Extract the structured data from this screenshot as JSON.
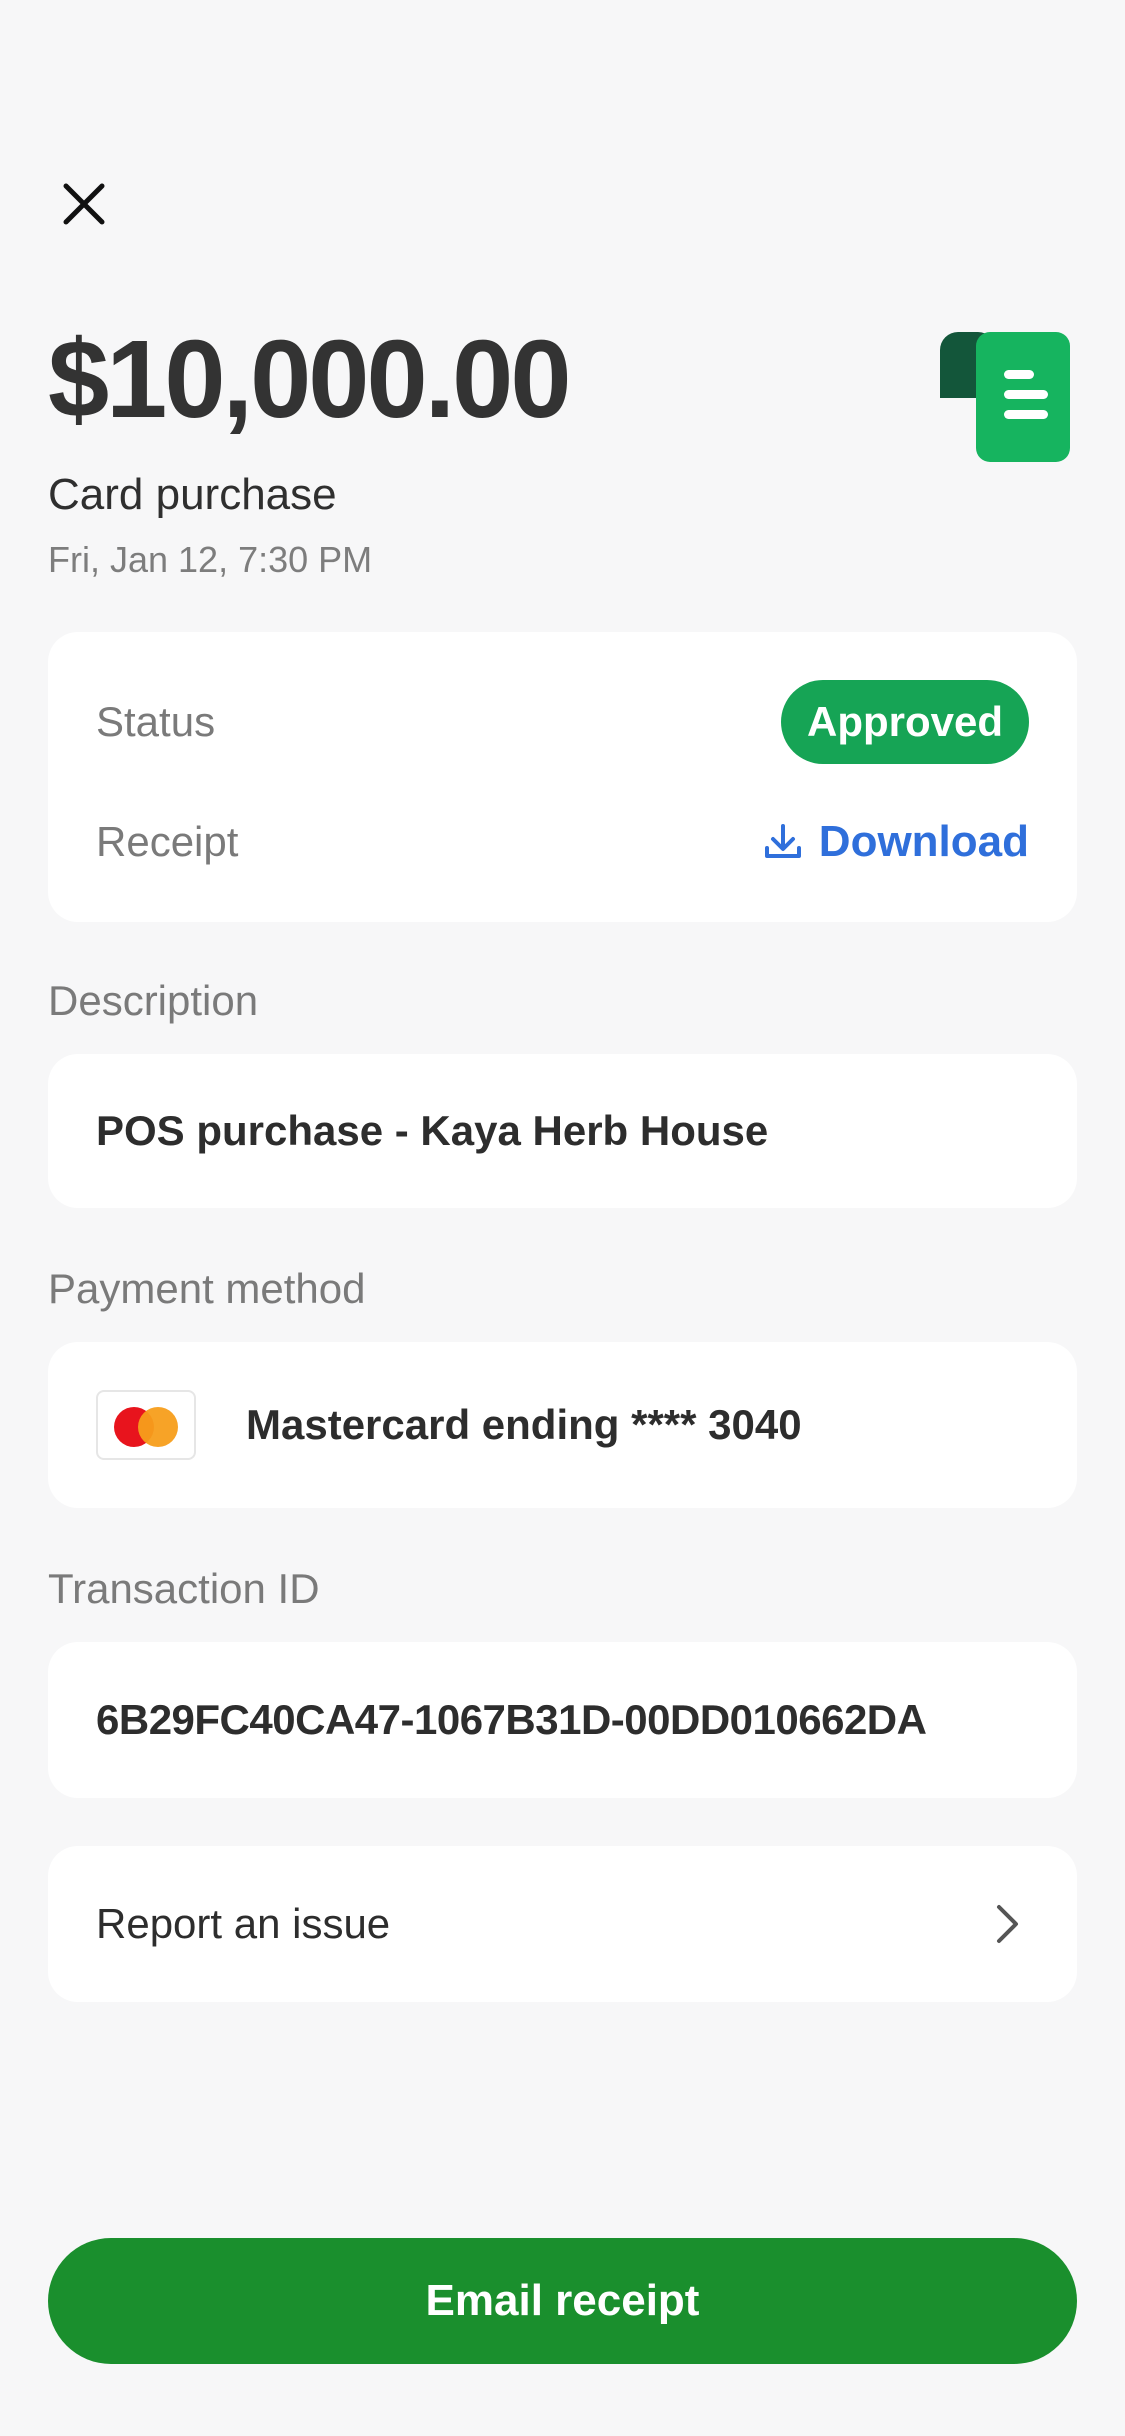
{
  "transaction": {
    "amount": "$10,000.00",
    "type": "Card purchase",
    "datetime": "Fri, Jan 12, 7:30 PM"
  },
  "status_card": {
    "status_label": "Status",
    "status_value": "Approved",
    "receipt_label": "Receipt",
    "download_label": "Download"
  },
  "description": {
    "label": "Description",
    "value": "POS purchase - Kaya Herb House"
  },
  "payment_method": {
    "label": "Payment method",
    "value": "Mastercard ending  **** 3040",
    "icon": "mastercard-logo"
  },
  "transaction_id": {
    "label": "Transaction ID",
    "value": "6B29FC40CA47-1067B31D-00DD010662DA"
  },
  "report": {
    "label": "Report an issue"
  },
  "email_button": {
    "label": "Email receipt"
  },
  "colors": {
    "background": "#f7f7f8",
    "approved_badge": "#16a455",
    "download_link": "#2f6fdb",
    "email_button": "#1a8f2d",
    "receipt_logo_dark": "#13563a",
    "receipt_logo_light": "#16b45f"
  }
}
